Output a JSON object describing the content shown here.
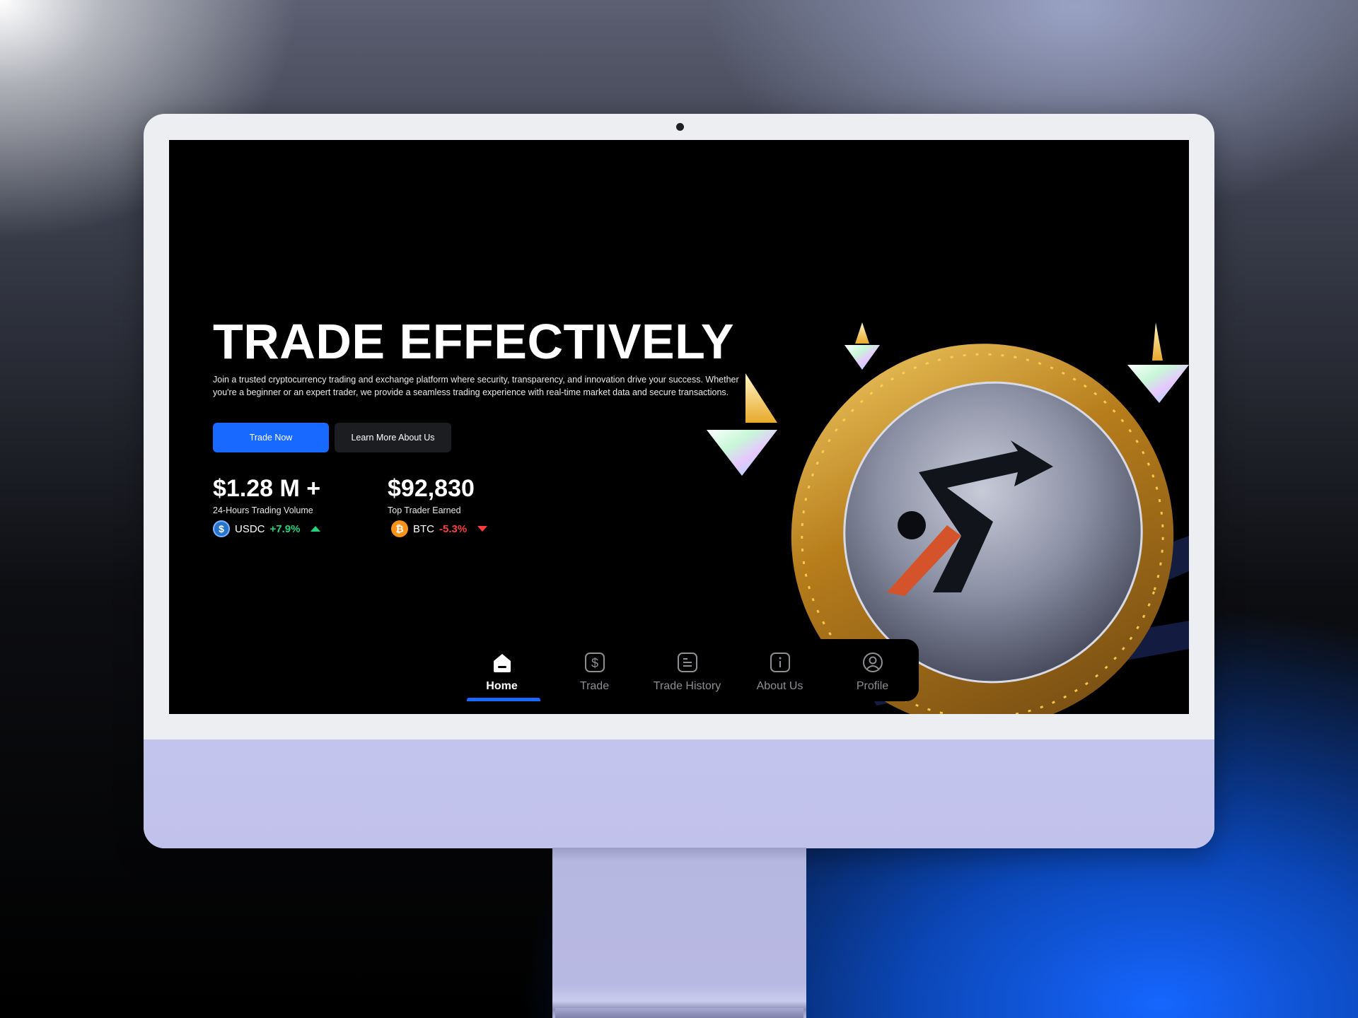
{
  "hero": {
    "title": "TRADE EFFECTIVELY",
    "description": "Join a trusted cryptocurrency trading and exchange platform where security, transparency, and innovation drive your success. Whether you're a beginner or an expert trader, we provide a seamless trading experience with real-time market data and secure transactions.",
    "primary_button": "Trade Now",
    "secondary_button": "Learn More About Us"
  },
  "stats": [
    {
      "value": "$1.28 M +",
      "label": "24-Hours Trading Volume",
      "coin": "USDC",
      "coin_glyph": "$",
      "change": "+7.9%",
      "direction": "up"
    },
    {
      "value": "$92,830",
      "label": "Top Trader Earned",
      "coin": "BTC",
      "coin_glyph": "₿",
      "change": "-5.3%",
      "direction": "down"
    }
  ],
  "nav": {
    "items": [
      {
        "label": "Home",
        "icon": "home-icon",
        "active": true
      },
      {
        "label": "Trade",
        "icon": "dollar-icon",
        "active": false
      },
      {
        "label": "Trade History",
        "icon": "document-icon",
        "active": false
      },
      {
        "label": "About Us",
        "icon": "info-icon",
        "active": false
      },
      {
        "label": "Profile",
        "icon": "user-icon",
        "active": false
      }
    ]
  },
  "colors": {
    "accent": "#1769ff",
    "positive": "#22d47e",
    "negative": "#ff3b3b",
    "coin_gold": "#e0a431",
    "chin": "#c3c4ee"
  }
}
